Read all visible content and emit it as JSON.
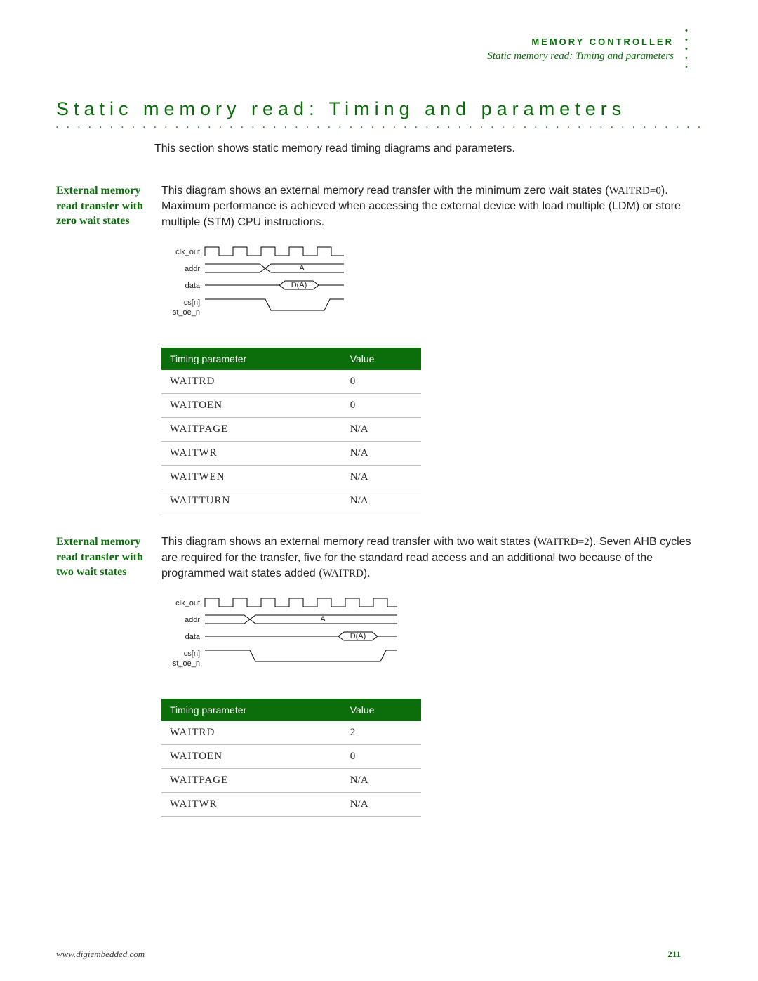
{
  "header": {
    "chapter": "MEMORY CONTROLLER",
    "subtitle": "Static memory read: Timing and parameters"
  },
  "section_title": "Static memory read: Timing and parameters",
  "intro": "This section shows static memory read timing diagrams and parameters.",
  "zero": {
    "sidehead": "External memory read transfer with zero wait states",
    "para_pre": "This diagram shows an external memory read transfer with the minimum zero wait states (",
    "waitrd_code": "WAITRD=0",
    "para_post": "). Maximum performance is achieved when accessing the external device with load multiple (LDM) or store multiple (STM) CPU instructions.",
    "signals": {
      "s0": "clk_out",
      "s1": "addr",
      "s2": "data",
      "s3": "cs[n]",
      "s4": "st_oe_n",
      "addr_label": "A",
      "data_label": "D(A)"
    },
    "table": {
      "h0": "Timing parameter",
      "h1": "Value",
      "rows": [
        {
          "p": "WAITRD",
          "v": "0"
        },
        {
          "p": "WAITOEN",
          "v": "0"
        },
        {
          "p": "WAITPAGE",
          "v": "N/A"
        },
        {
          "p": "WAITWR",
          "v": "N/A"
        },
        {
          "p": "WAITWEN",
          "v": "N/A"
        },
        {
          "p": "WAITTURN",
          "v": "N/A"
        }
      ]
    }
  },
  "two": {
    "sidehead": "External memory read transfer with two wait states",
    "para_pre": "This diagram shows an external memory read transfer with two wait states (",
    "waitrd_code": "WAITRD=2",
    "para_mid": "). Seven AHB cycles are required for the transfer, five for the standard read access and an additional two because of the programmed wait states added (",
    "waitrd_code2": "WAITRD",
    "para_post": ").",
    "signals": {
      "s0": "clk_out",
      "s1": "addr",
      "s2": "data",
      "s3": "cs[n]",
      "s4": "st_oe_n",
      "addr_label": "A",
      "data_label": "D(A)"
    },
    "table": {
      "h0": "Timing parameter",
      "h1": "Value",
      "rows": [
        {
          "p": "WAITRD",
          "v": "2"
        },
        {
          "p": "WAITOEN",
          "v": "0"
        },
        {
          "p": "WAITPAGE",
          "v": "N/A"
        },
        {
          "p": "WAITWR",
          "v": "N/A"
        }
      ]
    }
  },
  "footer": {
    "url": "www.digiembedded.com",
    "page_number": "211"
  }
}
